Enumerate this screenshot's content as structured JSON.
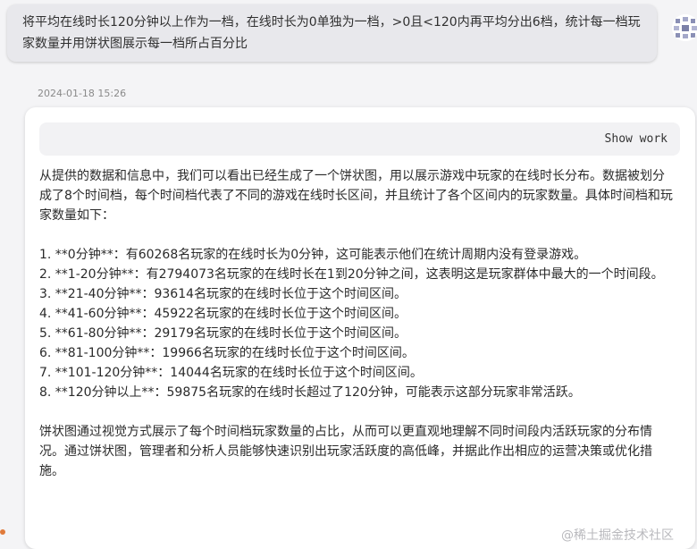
{
  "user_message": {
    "text": "将平均在线时长120分钟以上作为一档，在线时长为0单独为一档，>0且<120内再平均分出6档，统计每一档玩家数量并用饼状图展示每一档所占百分比"
  },
  "timestamp": "2024-01-18 15:26",
  "assistant": {
    "show_work_label": "Show work",
    "intro": "从提供的数据和信息中，我们可以看出已经生成了一个饼状图，用以展示游戏中玩家的在线时长分布。数据被划分成了8个时间档，每个时间档代表了不同的游戏在线时长区间，并且统计了各个区间内的玩家数量。具体时间档和玩家数量如下：",
    "items": [
      "1. **0分钟**：有60268名玩家的在线时长为0分钟，这可能表示他们在统计周期内没有登录游戏。",
      "2. **1-20分钟**：有2794073名玩家的在线时长在1到20分钟之间，这表明这是玩家群体中最大的一个时间段。",
      "3. **21-40分钟**：93614名玩家的在线时长位于这个时间区间。",
      "4. **41-60分钟**：45922名玩家的在线时长位于这个时间区间。",
      "5. **61-80分钟**：29179名玩家的在线时长位于这个时间区间。",
      "6. **81-100分钟**：19966名玩家的在线时长位于这个时间区间。",
      "7. **101-120分钟**：14044名玩家的在线时长位于这个时间区间。",
      "8. **120分钟以上**：59875名玩家的在线时长超过了120分钟，可能表示这部分玩家非常活跃。"
    ],
    "conclusion": "饼状图通过视觉方式展示了每个时间档玩家数量的占比，从而可以更直观地理解不同时间段内活跃玩家的分布情况。通过饼状图，管理者和分析人员能够快速识别出玩家活跃度的高低峰，并据此作出相应的运营决策或优化措施。"
  },
  "watermark": "@稀土掘金技术社区"
}
